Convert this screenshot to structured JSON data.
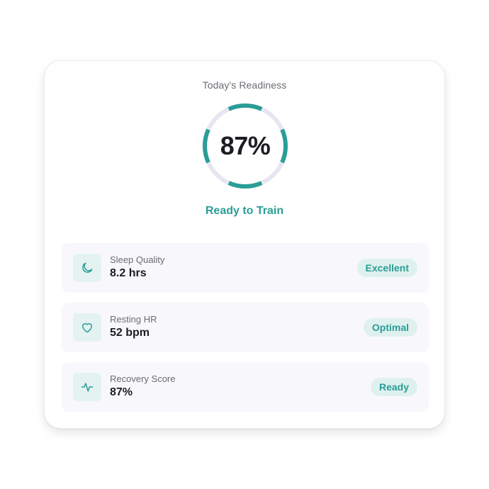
{
  "card": {
    "title": "Today's Readiness",
    "readiness": {
      "value_label": "87%",
      "fraction": 0.87,
      "ring_color": "#2a9d96",
      "track_color": "#e6e6f1"
    },
    "status_label": "Ready to Train",
    "metrics": [
      {
        "label": "Sleep Quality",
        "value": "8.2 hrs",
        "badge": "Excellent",
        "icon": "moon-icon"
      },
      {
        "label": "Resting HR",
        "value": "52 bpm",
        "badge": "Optimal",
        "icon": "heart-icon"
      },
      {
        "label": "Recovery Score",
        "value": "87%",
        "badge": "Ready",
        "icon": "activity-pulse-icon"
      }
    ]
  },
  "colors": {
    "accent": "#2a9d96",
    "badge_bg": "#dff1ef",
    "icon_bg": "#e4f3f2",
    "row_bg": "#f8f8fc"
  }
}
